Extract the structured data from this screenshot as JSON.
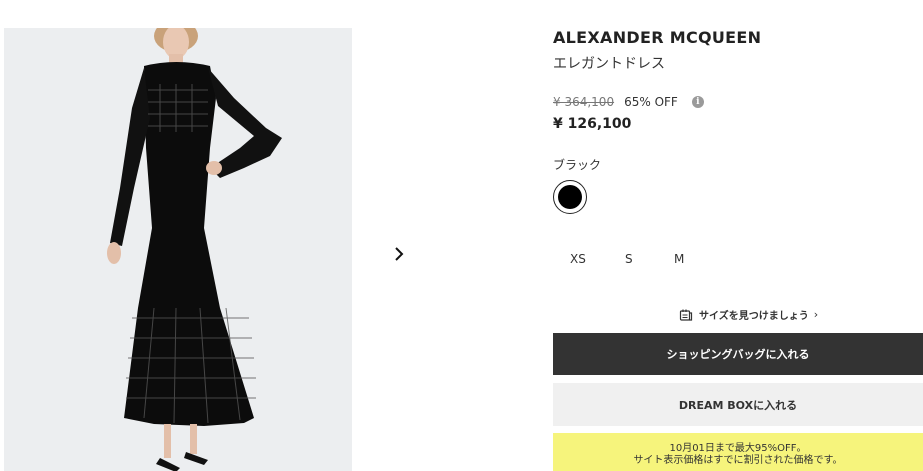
{
  "product": {
    "brand": "ALEXANDER MCQUEEN",
    "name": "エレガントドレス",
    "original_price": "¥ 364,100",
    "discount": "65% OFF",
    "price": "¥ 126,100",
    "color_label": "ブラック",
    "color_hex": "#000000",
    "sizes": [
      "XS",
      "S",
      "M"
    ]
  },
  "gallery": {
    "next_icon": "chevron-right-icon"
  },
  "size_finder": {
    "label": "サイズを見つけましょう",
    "icon": "size-guide-icon"
  },
  "actions": {
    "add_to_bag": "ショッピングバッグに入れる",
    "dream_box": "DREAM BOXに入れる"
  },
  "promo": {
    "line1": "10月01日まで最大95%OFF。",
    "line2": "サイト表示価格はすでに割引された価格です。"
  }
}
